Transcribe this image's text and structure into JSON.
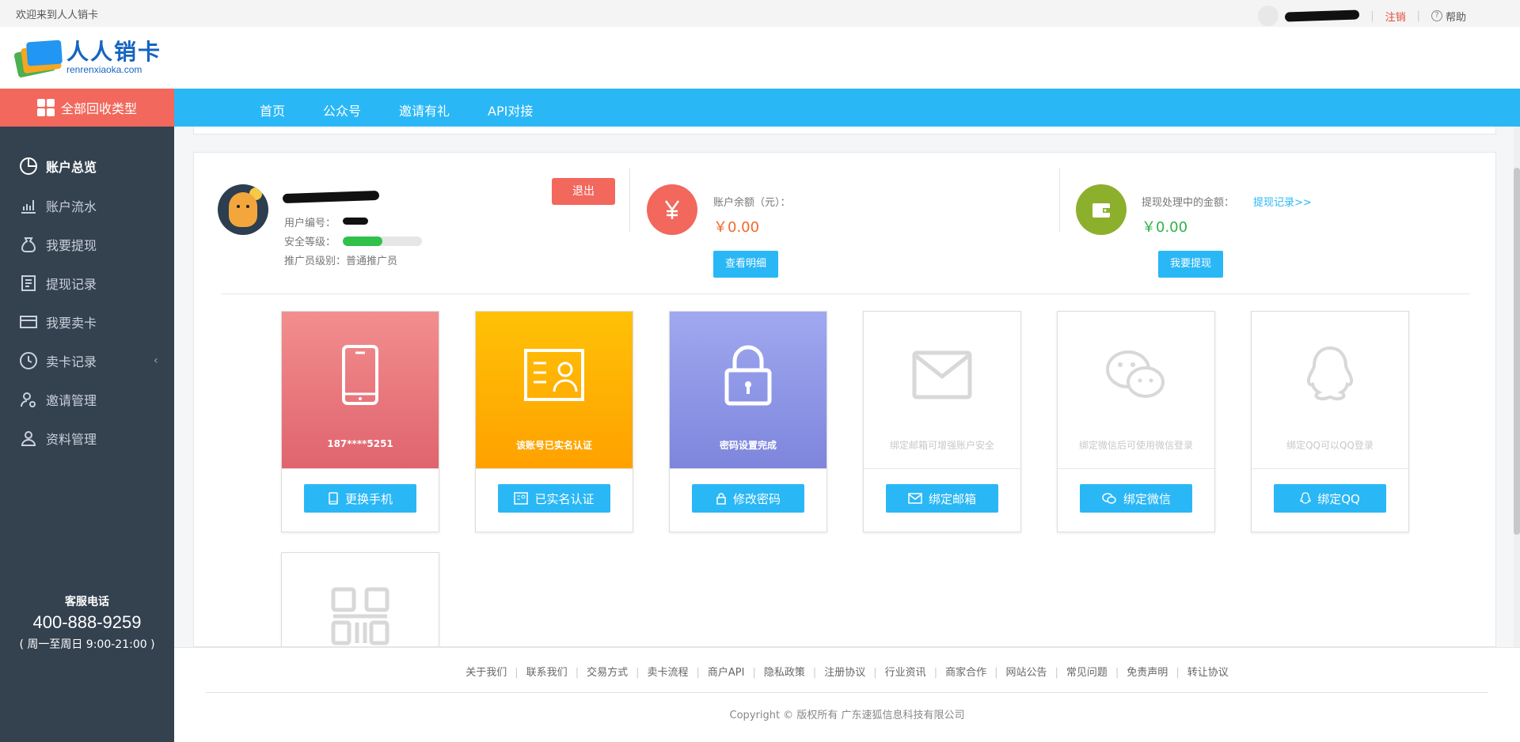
{
  "topbar": {
    "welcome": "欢迎来到人人销卡",
    "logout": "注销",
    "help": "帮助"
  },
  "logo": {
    "name": "人人销卡",
    "domain": "renrenxiaoka.com"
  },
  "nav": {
    "all_categories": "全部回收类型",
    "items": [
      "首页",
      "公众号",
      "邀请有礼",
      "API对接"
    ]
  },
  "sidebar": {
    "items": [
      {
        "label": "账户总览",
        "icon": "pie-chart-icon"
      },
      {
        "label": "账户流水",
        "icon": "bar-chart-icon"
      },
      {
        "label": "我要提现",
        "icon": "money-bag-icon"
      },
      {
        "label": "提现记录",
        "icon": "document-icon"
      },
      {
        "label": "我要卖卡",
        "icon": "card-icon"
      },
      {
        "label": "卖卡记录",
        "icon": "clock-icon"
      },
      {
        "label": "邀请管理",
        "icon": "user-invite-icon"
      },
      {
        "label": "资料管理",
        "icon": "user-icon"
      }
    ],
    "hotline_title": "客服电话",
    "hotline_number": "400-888-9259",
    "hotline_hours": "( 周一至周日 9:00-21:00 )"
  },
  "account": {
    "user_id_label": "用户编号：",
    "security_label": "安全等级：",
    "security_level": 0.5,
    "promoter_label": "推广员级别：普通推广员",
    "exit_button": "退出",
    "balance_label": "账户余额（元）：",
    "balance_value": "￥0.00",
    "view_details": "查看明细",
    "pending_label": "提现处理中的金额：",
    "pending_link": "提现记录>>",
    "pending_value": "￥0.00",
    "withdraw_button": "我要提现"
  },
  "cards": [
    {
      "caption": "187****5251",
      "button": "更换手机",
      "icon": "phone-icon"
    },
    {
      "caption": "该账号已实名认证",
      "button": "已实名认证",
      "icon": "id-card-icon"
    },
    {
      "caption": "密码设置完成",
      "button": "修改密码",
      "icon": "lock-icon"
    },
    {
      "caption": "绑定邮箱可增强账户安全",
      "button": "绑定邮箱",
      "icon": "mail-icon"
    },
    {
      "caption": "绑定微信后可使用微信登录",
      "button": "绑定微信",
      "icon": "wechat-icon"
    },
    {
      "caption": "绑定QQ可以QQ登录",
      "button": "绑定QQ",
      "icon": "qq-icon"
    },
    {
      "caption": "",
      "button": "",
      "icon": "qr-code-icon"
    }
  ],
  "colors": {
    "accent": "#2ab7f6",
    "red": "#f2685c",
    "yellow": "#ffb300",
    "purple": "#8a93e6",
    "sidebar": "#34414f"
  },
  "footer": {
    "links": [
      "关于我们",
      "联系我们",
      "交易方式",
      "卖卡流程",
      "商户API",
      "隐私政策",
      "注册协议",
      "行业资讯",
      "商家合作",
      "网站公告",
      "常见问题",
      "免责声明",
      "转让协议"
    ],
    "copyright": "Copyright © 版权所有 广东速狐信息科技有限公司"
  }
}
